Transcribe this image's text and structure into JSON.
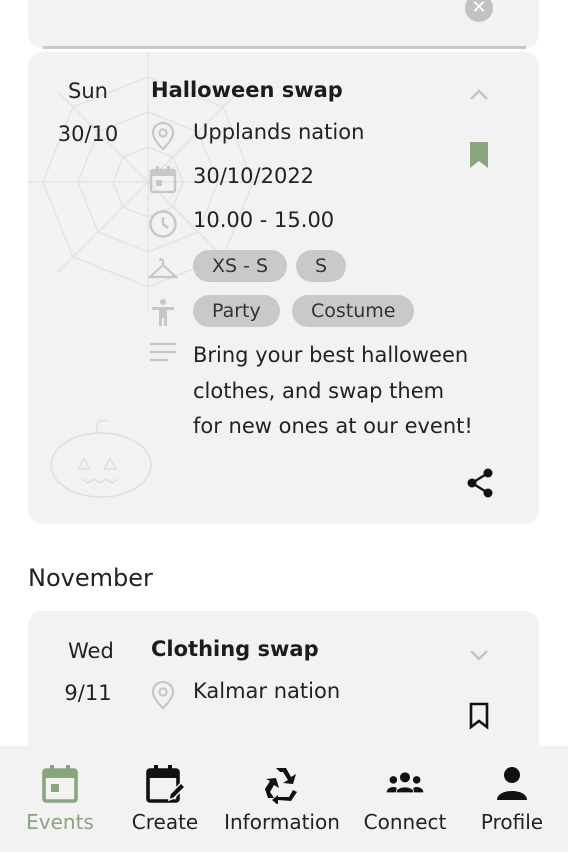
{
  "top_card": {
    "close_icon": "close-icon"
  },
  "events": [
    {
      "day": "Sun",
      "date": "30/10",
      "title": "Halloween swap",
      "location": "Upplands nation",
      "event_date": "30/10/2022",
      "time": "10.00 - 15.00",
      "sizes": [
        "XS - S",
        "S"
      ],
      "tags": [
        "Party",
        "Costume"
      ],
      "description_lines": [
        "Bring your best halloween",
        "clothes, and swap them",
        "for new ones at our event!"
      ],
      "bookmarked": true,
      "expanded": true
    },
    {
      "day": "Wed",
      "date": "9/11",
      "title": "Clothing swap",
      "location": "Kalmar nation",
      "bookmarked": false,
      "expanded": false
    }
  ],
  "month_heading": "November",
  "colors": {
    "accent": "#8aa57e",
    "card": "#f2f2f2",
    "chip": "#c9c9c9",
    "icon_muted": "#c7c7c7"
  },
  "nav": {
    "items": [
      {
        "label": "Events",
        "icon": "calendar-icon",
        "active": true
      },
      {
        "label": "Create",
        "icon": "calendar-edit-icon",
        "active": false
      },
      {
        "label": "Information",
        "icon": "recycle-icon",
        "active": false
      },
      {
        "label": "Connect",
        "icon": "group-icon",
        "active": false
      },
      {
        "label": "Profile",
        "icon": "person-icon",
        "active": false
      }
    ]
  }
}
